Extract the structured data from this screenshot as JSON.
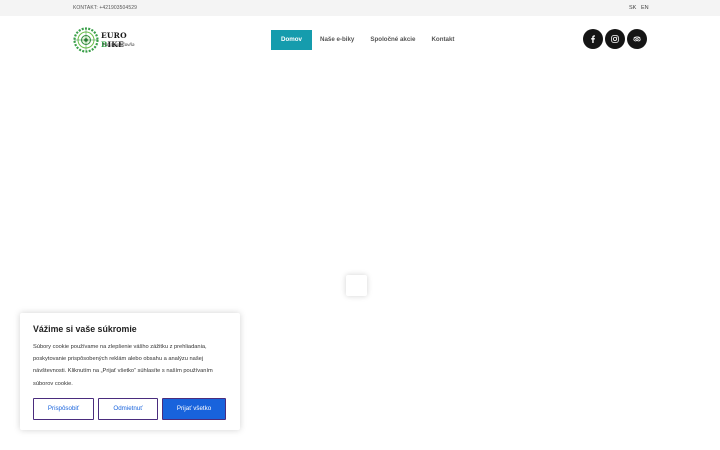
{
  "topbar": {
    "contact": "KONTAKT: +421903504529",
    "languages": [
      "SK",
      "EN"
    ]
  },
  "logo": {
    "brand_part1": "EURO ",
    "brand_o": "B",
    "brand_part2": "IKE",
    "tagline": "Tvoja požičovňa"
  },
  "nav": {
    "items": [
      {
        "label": "Domov",
        "active": true
      },
      {
        "label": "Naše e-biky",
        "active": false
      },
      {
        "label": "Spoločné akcie",
        "active": false
      },
      {
        "label": "Kontakt",
        "active": false
      }
    ]
  },
  "social": {
    "icons": [
      "facebook-icon",
      "instagram-icon",
      "tripadvisor-icon"
    ]
  },
  "cookie": {
    "title": "Vážime si vaše súkromie",
    "text": "Súbory cookie používame na zlepšenie vášho zážitku z prehliadania, poskytovanie prispôsobených reklám alebo obsahu a analýzu našej návštevnosti. Kliknutím na „Prijať všetko“ súhlasíte s naším používaním súborov cookie.",
    "customize": "Prispôsobiť",
    "reject": "Odmietnuť",
    "accept": "Prijať všetko"
  },
  "colors": {
    "nav_active": "#159cad",
    "accept_button": "#1863dc",
    "social_bg": "#151515"
  }
}
